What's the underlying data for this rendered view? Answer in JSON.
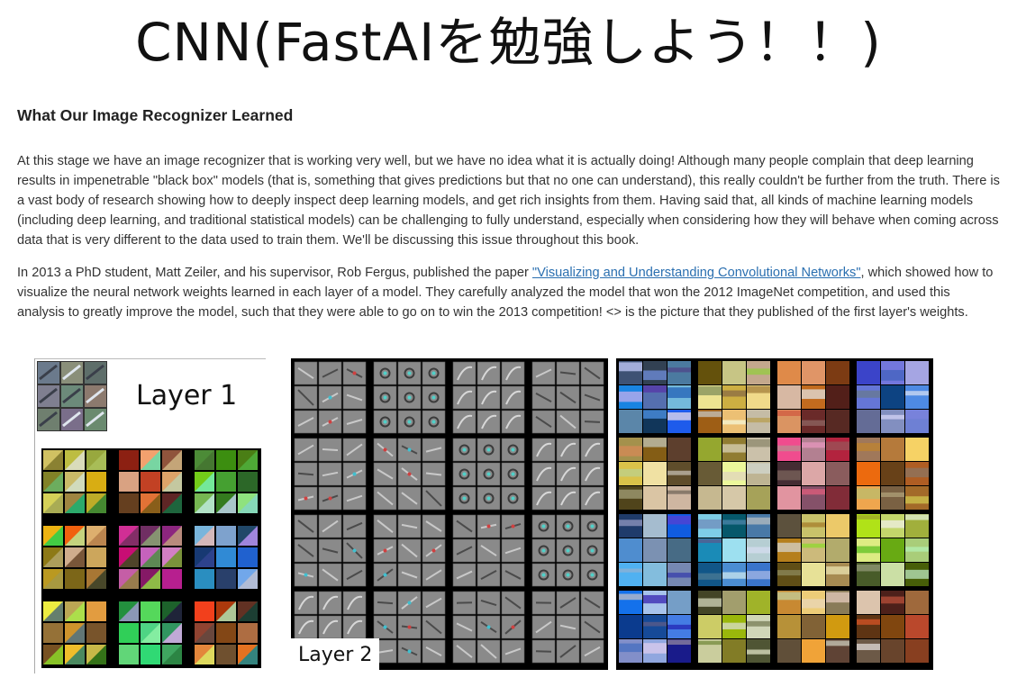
{
  "slide": {
    "title": "CNN(FastAIを勉強しよう！！)"
  },
  "article": {
    "heading": "What Our Image Recognizer Learned",
    "paragraph1": "At this stage we have an image recognizer that is working very well, but we have no idea what it is actually doing! Although many people complain that deep learning results in impenetrable \"black box\" models (that is, something that gives predictions but that no one can understand), this really couldn't be further from the truth. There is a vast body of research showing how to deeply inspect deep learning models, and get rich insights from them. Having said that, all kinds of machine learning models (including deep learning, and traditional statistical models) can be challenging to fully understand, especially when considering how they will behave when coming across data that is very different to the data used to train them. We'll be discussing this issue throughout this book.",
    "paragraph2_before": "In 2013 a PhD student, Matt Zeiler, and his supervisor, Rob Fergus, published the paper ",
    "paragraph2_link": "\"Visualizing and Understanding Convolutional Networks\"",
    "paragraph2_after": ", which showed how to visualize the neural network weights learned in each layer of a model. They carefully analyzed the model that won the 2012 ImageNet competition, and used this analysis to greatly improve the model, such that they were able to go on to win the 2013 competition! <> is the picture that they published of the first layer's weights."
  },
  "figure": {
    "layer1_label": "Layer 1",
    "layer2_label": "Layer 2"
  },
  "colors": {
    "link": "#2a6fb0",
    "text": "#333333",
    "layer2_gray": "#8a8a8a"
  }
}
